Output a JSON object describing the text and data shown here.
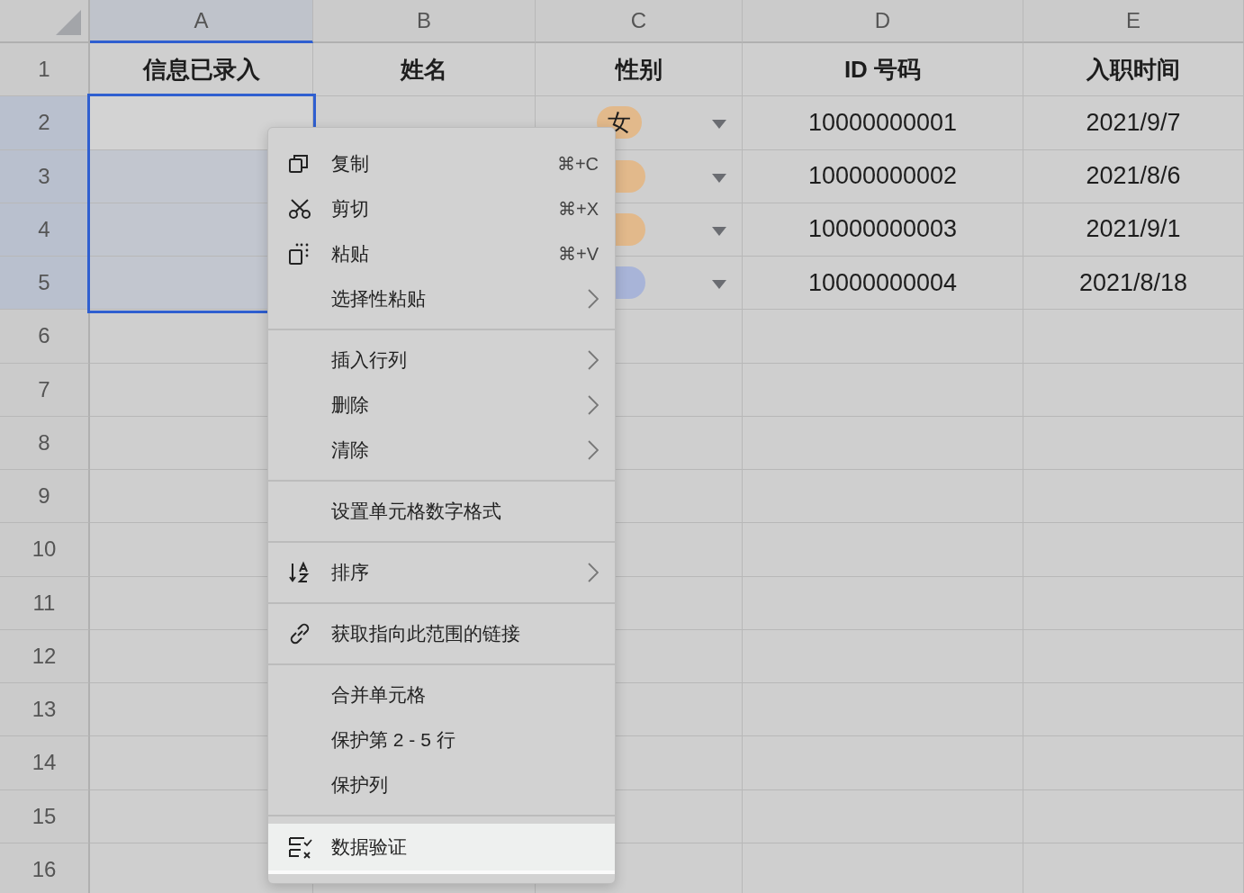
{
  "columns": [
    {
      "label": "A",
      "selected": true
    },
    {
      "label": "B",
      "selected": false
    },
    {
      "label": "C",
      "selected": false
    },
    {
      "label": "D",
      "selected": false
    },
    {
      "label": "E",
      "selected": false
    }
  ],
  "header_row": {
    "number": "1",
    "cells": [
      "信息已录入",
      "姓名",
      "性别",
      "ID 号码",
      "入职时间"
    ]
  },
  "rows": [
    {
      "number": "2",
      "selected": true,
      "gender": {
        "label": "女",
        "color": "#e2b98b"
      },
      "id": "10000000001",
      "date": "2021/9/7"
    },
    {
      "number": "3",
      "selected": true,
      "gender": {
        "color": "#e2b98b"
      },
      "id": "10000000002",
      "date": "2021/8/6"
    },
    {
      "number": "4",
      "selected": true,
      "gender": {
        "color": "#e2b98b"
      },
      "id": "10000000003",
      "date": "2021/9/1"
    },
    {
      "number": "5",
      "selected": true,
      "gender": {
        "color": "#a8b4d8"
      },
      "id": "10000000004",
      "date": "2021/8/18"
    },
    {
      "number": "6",
      "selected": false
    },
    {
      "number": "7",
      "selected": false
    },
    {
      "number": "8",
      "selected": false
    },
    {
      "number": "9",
      "selected": false
    },
    {
      "number": "10",
      "selected": false
    },
    {
      "number": "11",
      "selected": false
    },
    {
      "number": "12",
      "selected": false
    },
    {
      "number": "13",
      "selected": false
    },
    {
      "number": "14",
      "selected": false
    },
    {
      "number": "15",
      "selected": false
    },
    {
      "number": "16",
      "selected": false
    }
  ],
  "context_menu": {
    "groups": [
      {
        "items": [
          {
            "kind": "copy",
            "label": "复制",
            "shortcut": "⌘+C",
            "submenu": false,
            "highlighted": false
          },
          {
            "kind": "scissors",
            "label": "剪切",
            "shortcut": "⌘+X",
            "submenu": false,
            "highlighted": false
          },
          {
            "kind": "paste",
            "label": "粘贴",
            "shortcut": "⌘+V",
            "submenu": false,
            "highlighted": false
          },
          {
            "label": "选择性粘贴",
            "submenu": true,
            "highlighted": false
          }
        ]
      },
      {
        "items": [
          {
            "label": "插入行列",
            "submenu": true,
            "highlighted": false
          },
          {
            "label": "删除",
            "submenu": true,
            "highlighted": false
          },
          {
            "label": "清除",
            "submenu": true,
            "highlighted": false
          }
        ]
      },
      {
        "items": [
          {
            "label": "设置单元格数字格式",
            "submenu": false,
            "highlighted": false
          }
        ]
      },
      {
        "items": [
          {
            "kind": "sort",
            "label": "排序",
            "submenu": true,
            "highlighted": false
          }
        ]
      },
      {
        "items": [
          {
            "kind": "link",
            "label": "获取指向此范围的链接",
            "submenu": false,
            "highlighted": false
          }
        ]
      },
      {
        "items": [
          {
            "label": "合并单元格",
            "submenu": false,
            "highlighted": false
          },
          {
            "label": "保护第 2 - 5 行",
            "submenu": false,
            "highlighted": false
          },
          {
            "label": "保护列",
            "submenu": false,
            "highlighted": false
          }
        ]
      },
      {
        "items": [
          {
            "kind": "validation",
            "label": "数据验证",
            "submenu": false,
            "highlighted": true
          }
        ]
      }
    ]
  }
}
